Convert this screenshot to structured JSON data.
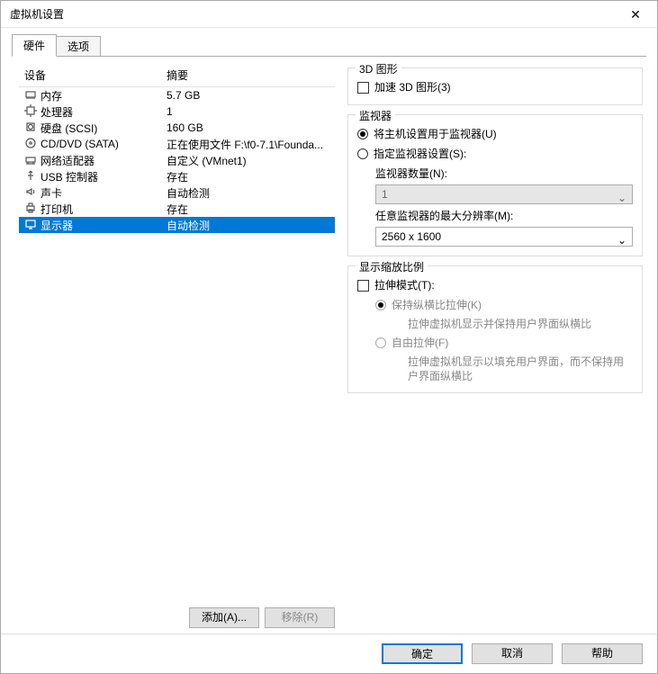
{
  "window": {
    "title": "虚拟机设置"
  },
  "tabs": {
    "hardware": "硬件",
    "options": "选项"
  },
  "columns": {
    "device": "设备",
    "summary": "摘要"
  },
  "devices": [
    {
      "icon": "memory",
      "name": "内存",
      "summary": "5.7 GB"
    },
    {
      "icon": "cpu",
      "name": "处理器",
      "summary": "1"
    },
    {
      "icon": "disk",
      "name": "硬盘 (SCSI)",
      "summary": "160 GB"
    },
    {
      "icon": "cd",
      "name": "CD/DVD (SATA)",
      "summary": "正在使用文件 F:\\f0-7.1\\Founda..."
    },
    {
      "icon": "net",
      "name": "网络适配器",
      "summary": "自定义 (VMnet1)"
    },
    {
      "icon": "usb",
      "name": "USB 控制器",
      "summary": "存在"
    },
    {
      "icon": "sound",
      "name": "声卡",
      "summary": "自动检测"
    },
    {
      "icon": "printer",
      "name": "打印机",
      "summary": "存在"
    },
    {
      "icon": "display",
      "name": "显示器",
      "summary": "自动检测",
      "selected": true
    }
  ],
  "left_buttons": {
    "add": "添加(A)...",
    "remove": "移除(R)"
  },
  "panel_3d": {
    "legend": "3D 图形",
    "accelerate": "加速 3D 图形(3)"
  },
  "panel_monitor": {
    "legend": "监视器",
    "use_host": "将主机设置用于监视器(U)",
    "specify": "指定监视器设置(S):",
    "count_label": "监视器数量(N):",
    "count_value": "1",
    "maxres_label": "任意监视器的最大分辨率(M):",
    "maxres_value": "2560 x 1600"
  },
  "panel_scale": {
    "legend": "显示缩放比例",
    "stretch_mode": "拉伸模式(T):",
    "keep_ratio": "保持纵横比拉伸(K)",
    "keep_ratio_desc": "拉伸虚拟机显示并保持用户界面纵横比",
    "free": "自由拉伸(F)",
    "free_desc": "拉伸虚拟机显示以填充用户界面，而不保持用户界面纵横比"
  },
  "footer": {
    "ok": "确定",
    "cancel": "取消",
    "help": "帮助"
  }
}
